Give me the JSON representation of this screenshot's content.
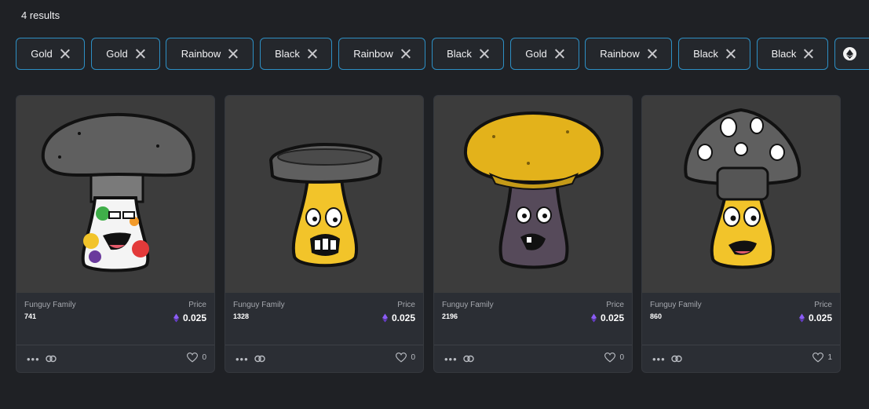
{
  "results_text": "4 results",
  "filters": [
    {
      "label": "Gold"
    },
    {
      "label": "Gold"
    },
    {
      "label": "Rainbow"
    },
    {
      "label": "Black"
    },
    {
      "label": "Rainbow"
    },
    {
      "label": "Black"
    },
    {
      "label": "Gold"
    },
    {
      "label": "Rainbow"
    },
    {
      "label": "Black"
    },
    {
      "label": "Black"
    }
  ],
  "eth_filter_icon": "ethereum-icon",
  "cards": [
    {
      "collection": "Funguy Family",
      "token": "741",
      "price_label": "Price",
      "price": "0.025",
      "likes": "0",
      "cap_color": "#5f5f5f",
      "face_color": "rainbow"
    },
    {
      "collection": "Funguy Family",
      "token": "1328",
      "price_label": "Price",
      "price": "0.025",
      "likes": "0",
      "cap_color": "#5f5f5f",
      "face_color": "#f2c42a"
    },
    {
      "collection": "Funguy Family",
      "token": "2196",
      "price_label": "Price",
      "price": "0.025",
      "likes": "0",
      "cap_color": "#e3b21b",
      "face_color": "#564a5a"
    },
    {
      "collection": "Funguy Family",
      "token": "860",
      "price_label": "Price",
      "price": "0.025",
      "likes": "1",
      "cap_color": "#5f5f5f",
      "face_color": "#f2c42a"
    }
  ],
  "colors": {
    "accent": "#2d8fc4",
    "eth": "#8b5cf6",
    "background": "#1f2125",
    "card": "#2b2e34"
  }
}
